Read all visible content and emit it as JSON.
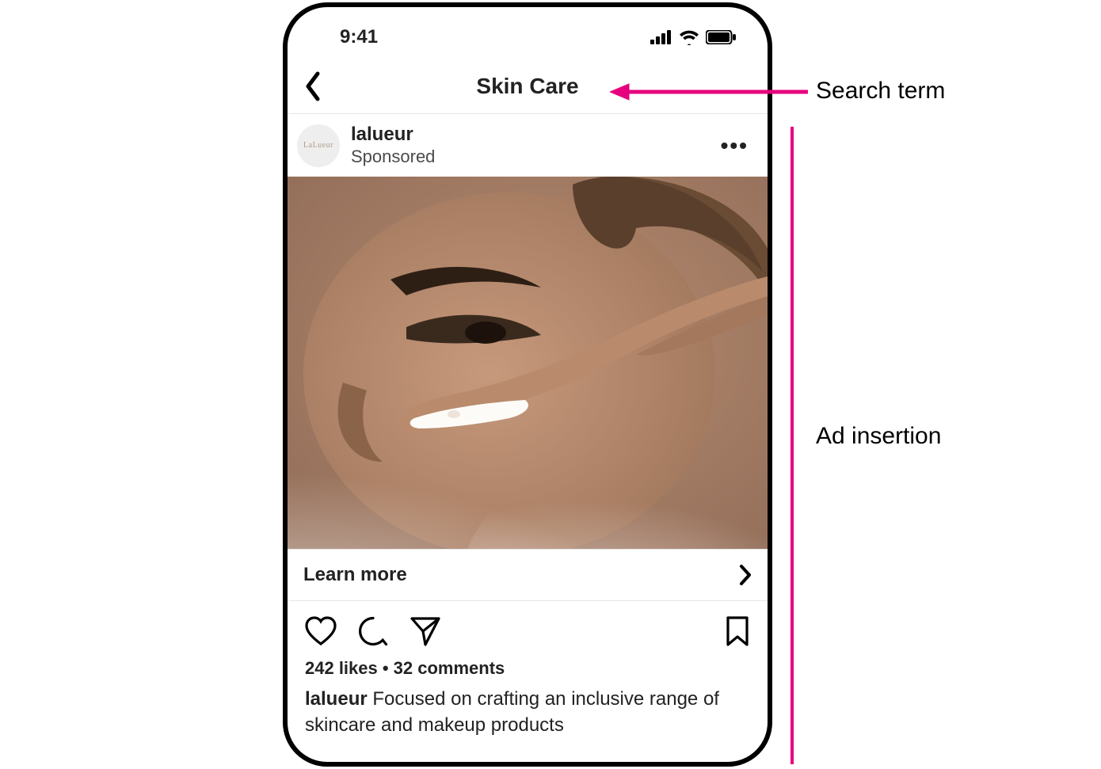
{
  "statusbar": {
    "time": "9:41"
  },
  "nav": {
    "title": "Skin Care"
  },
  "post": {
    "avatar_text": "LaLueur",
    "username": "lalueur",
    "sponsored_label": "Sponsored",
    "cta_label": "Learn more",
    "likes_count": 242,
    "comments_count": 32,
    "meta_text": "242 likes • 32 comments",
    "caption_handle": "lalueur",
    "caption_text": " Focused on crafting an inclusive range of skincare and makeup products"
  },
  "annotations": {
    "search_term": "Search term",
    "ad_insertion": "Ad insertion"
  },
  "colors": {
    "accent": "#e6007e"
  }
}
